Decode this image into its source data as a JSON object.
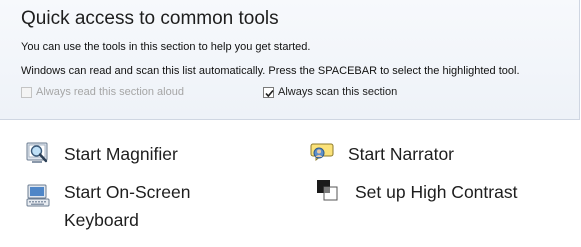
{
  "section": {
    "title": "Quick access to common tools",
    "description_1": "You can use the tools in this section to help you get started.",
    "description_2": "Windows can read and scan this list automatically.  Press the SPACEBAR to select the highlighted tool.",
    "checkboxes": [
      {
        "label": "Always read this section aloud",
        "checked": false,
        "disabled": true
      },
      {
        "label": "Always scan this section",
        "checked": true,
        "disabled": false
      }
    ]
  },
  "tools": [
    {
      "label": "Start Magnifier",
      "icon": "magnifier-icon"
    },
    {
      "label": "Start Narrator",
      "icon": "narrator-icon"
    },
    {
      "label": "Start On-Screen Keyboard",
      "icon": "keyboard-icon"
    },
    {
      "label": "Set up High Contrast",
      "icon": "high-contrast-icon"
    }
  ],
  "colors": {
    "panel_background": "#eef2f8",
    "panel_border": "#cfd6e2",
    "disabled_text": "#a6a6a6"
  }
}
